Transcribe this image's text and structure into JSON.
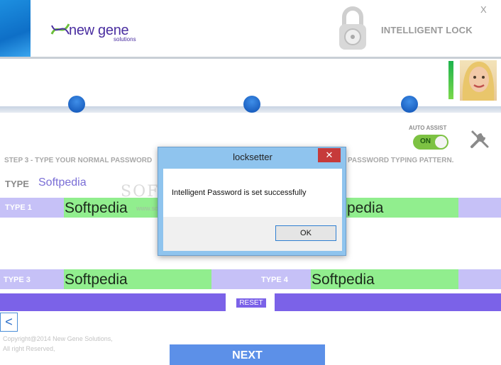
{
  "header": {
    "brand_name": "new gene",
    "brand_sub": "solutions",
    "product_title": "INTELLIGENT LOCK",
    "close_label": "X"
  },
  "auto_assist": {
    "label": "AUTO ASSIST",
    "toggle_state": "ON"
  },
  "steps": {
    "step3_left": "STEP 3 - TYPE YOUR NORMAL PASSWORD",
    "step3_right": "PASSWORD TYPING PATTERN."
  },
  "type_field": {
    "label": "TYPE",
    "value": "Softpedia"
  },
  "rows": {
    "type1": {
      "label": "TYPE 1",
      "left_value": "Softpedia",
      "right_value": "pedia"
    },
    "type3": {
      "label": "TYPE 3",
      "value": "Softpedia"
    },
    "type4": {
      "label": "TYPE 4",
      "value": "Softpedia"
    }
  },
  "buttons": {
    "reset": "RESET",
    "back": "<",
    "next": "NEXT"
  },
  "footer": {
    "copyright_line1": "Copyright@2014 New Gene Solutions,",
    "copyright_line2": "All right Reserved,"
  },
  "watermark": {
    "text": "SOFTPEDIA",
    "url": "www.softpedia.com"
  },
  "dialog": {
    "title": "locksetter",
    "close_label": "✕",
    "message": "Intelligent Password is set successfully",
    "ok_label": "OK"
  },
  "colors": {
    "accent_purple": "#7b62e8",
    "row_lavender": "#c6c1f7",
    "row_green": "#91ee8e",
    "next_blue": "#5c90e8",
    "toggle_green": "#7dc243"
  },
  "icons": {
    "lock": "padlock-icon",
    "tools": "wrench-screwdriver-icon",
    "avatar": "user-avatar"
  }
}
